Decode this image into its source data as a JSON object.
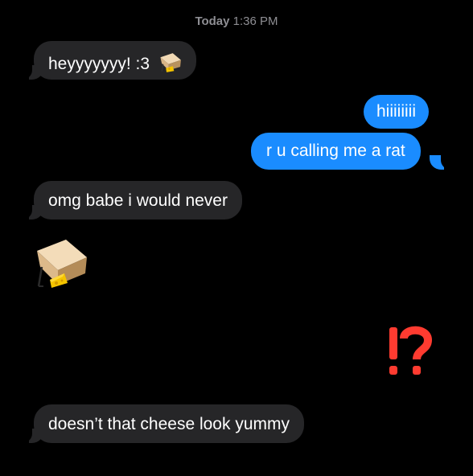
{
  "header": {
    "day": "Today",
    "time": "1:36 PM"
  },
  "messages": [
    {
      "direction": "incoming",
      "text": "heyyyyyyy! :3",
      "emoji": "mousetrap-icon"
    },
    {
      "direction": "outgoing",
      "text": "hiiiiiiii"
    },
    {
      "direction": "outgoing",
      "text": "r u calling me a rat"
    },
    {
      "direction": "incoming",
      "text": "omg babe i would never"
    },
    {
      "direction": "incoming",
      "emoji": "mousetrap-icon"
    },
    {
      "direction": "outgoing",
      "emoji": "exclamation-question-icon"
    },
    {
      "direction": "incoming",
      "text": "doesn’t that cheese look yummy"
    }
  ],
  "colors": {
    "background": "#000000",
    "incoming_bubble": "#262628",
    "outgoing_bubble": "#1a8cff",
    "timestamp": "#8e8e93",
    "interrobang": "#ff3b30"
  }
}
